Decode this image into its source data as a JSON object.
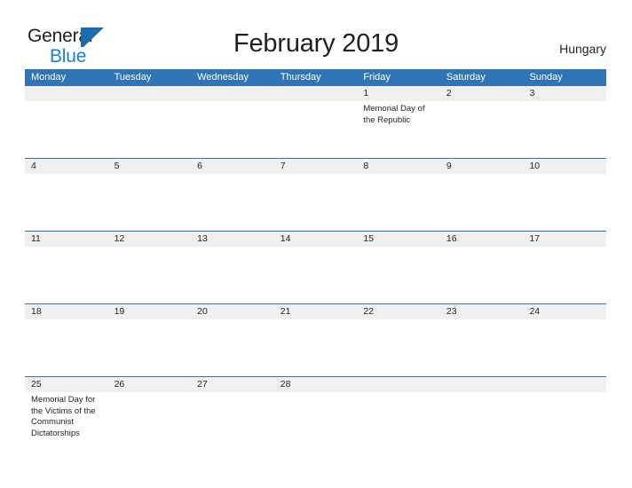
{
  "branding": {
    "logo_line1": "General",
    "logo_line2": "Blue",
    "logo_mark": "blue-triangle-icon"
  },
  "header": {
    "title": "February 2019",
    "country": "Hungary"
  },
  "theme": {
    "header_blue": "#2f75b5",
    "band_gray": "#f0f0f0",
    "text_dark": "#231f20",
    "logo_blue": "#1b7fd4"
  },
  "calendar": {
    "month": "February",
    "year": "2019",
    "weekday_headers": [
      "Monday",
      "Tuesday",
      "Wednesday",
      "Thursday",
      "Friday",
      "Saturday",
      "Sunday"
    ],
    "weeks": [
      [
        {
          "day": "",
          "holiday": ""
        },
        {
          "day": "",
          "holiday": ""
        },
        {
          "day": "",
          "holiday": ""
        },
        {
          "day": "",
          "holiday": ""
        },
        {
          "day": "1",
          "holiday": "Memorial Day of the Republic"
        },
        {
          "day": "2",
          "holiday": ""
        },
        {
          "day": "3",
          "holiday": ""
        }
      ],
      [
        {
          "day": "4",
          "holiday": ""
        },
        {
          "day": "5",
          "holiday": ""
        },
        {
          "day": "6",
          "holiday": ""
        },
        {
          "day": "7",
          "holiday": ""
        },
        {
          "day": "8",
          "holiday": ""
        },
        {
          "day": "9",
          "holiday": ""
        },
        {
          "day": "10",
          "holiday": ""
        }
      ],
      [
        {
          "day": "11",
          "holiday": ""
        },
        {
          "day": "12",
          "holiday": ""
        },
        {
          "day": "13",
          "holiday": ""
        },
        {
          "day": "14",
          "holiday": ""
        },
        {
          "day": "15",
          "holiday": ""
        },
        {
          "day": "16",
          "holiday": ""
        },
        {
          "day": "17",
          "holiday": ""
        }
      ],
      [
        {
          "day": "18",
          "holiday": ""
        },
        {
          "day": "19",
          "holiday": ""
        },
        {
          "day": "20",
          "holiday": ""
        },
        {
          "day": "21",
          "holiday": ""
        },
        {
          "day": "22",
          "holiday": ""
        },
        {
          "day": "23",
          "holiday": ""
        },
        {
          "day": "24",
          "holiday": ""
        }
      ],
      [
        {
          "day": "25",
          "holiday": "Memorial Day for the Victims of the Communist Dictatorships"
        },
        {
          "day": "26",
          "holiday": ""
        },
        {
          "day": "27",
          "holiday": ""
        },
        {
          "day": "28",
          "holiday": ""
        },
        {
          "day": "",
          "holiday": ""
        },
        {
          "day": "",
          "holiday": ""
        },
        {
          "day": "",
          "holiday": ""
        }
      ]
    ]
  }
}
